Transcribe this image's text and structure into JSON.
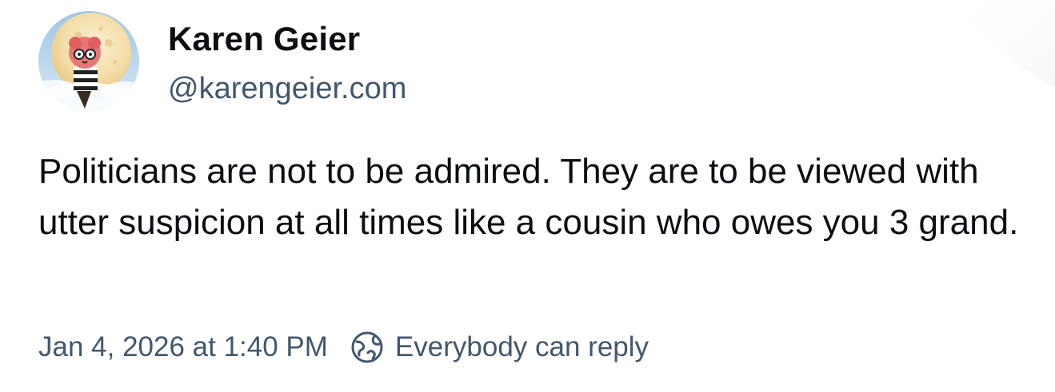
{
  "author": {
    "display_name": "Karen Geier",
    "handle": "@karengeier.com",
    "avatar_icon": "avatar-image"
  },
  "post": {
    "text": "Politicians are not to be admired. They are to be viewed with utter suspicion at all times like a cousin who owes you 3 grand."
  },
  "meta": {
    "timestamp": "Jan 4, 2026 at 1:40 PM",
    "reply_setting_label": "Everybody can reply",
    "reply_setting_icon": "globe-icon"
  },
  "colors": {
    "text_primary": "#0b0f14",
    "text_secondary": "#42576c",
    "background": "#ffffff"
  }
}
